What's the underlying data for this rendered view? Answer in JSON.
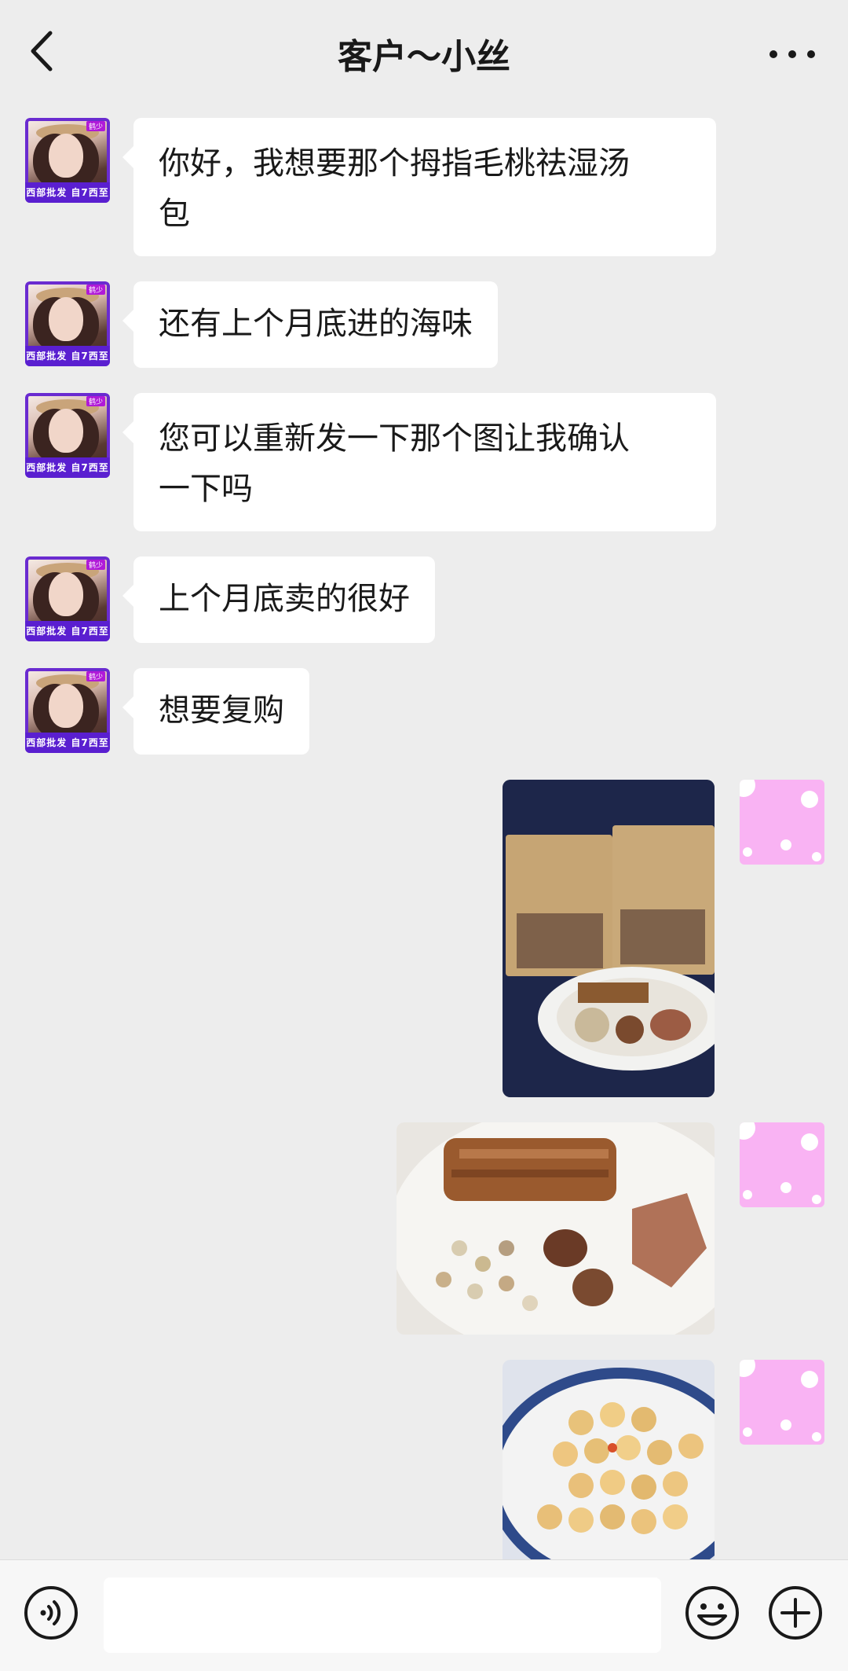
{
  "header": {
    "title": "客户～小丝",
    "back_icon": "chevron-left-icon",
    "more_icon": "more-horizontal-icon"
  },
  "contact_avatar": {
    "banner_text": "西部批发 自7西至",
    "tag_text": "鹤少"
  },
  "messages": [
    {
      "sender": "contact",
      "type": "text",
      "text": "你好，我想要那个拇指毛桃祛湿汤\n包"
    },
    {
      "sender": "contact",
      "type": "text",
      "text": "还有上个月底进的海味"
    },
    {
      "sender": "contact",
      "type": "text",
      "text": "您可以重新发一下那个图让我确认\n一下吗"
    },
    {
      "sender": "contact",
      "type": "text",
      "text": "上个月底卖的很好"
    },
    {
      "sender": "contact",
      "type": "text",
      "text": "想要复购"
    },
    {
      "sender": "self",
      "type": "image",
      "content": "photo of two soup ingredient packs and a plate of dried herbs"
    },
    {
      "sender": "self",
      "type": "image",
      "content": "photo of plate with dried roots, seeds and mushrooms"
    },
    {
      "sender": "self",
      "type": "image",
      "content": "photo of plate with dried scallops"
    }
  ],
  "colors": {
    "background": "#ededed",
    "bubble": "#ffffff",
    "self_avatar": "#f9b3f3",
    "contact_avatar_border": "#6a2bd0"
  },
  "input_bar": {
    "placeholder": "",
    "voice_icon": "voice-icon",
    "emoji_icon": "emoji-icon",
    "plus_icon": "plus-icon"
  }
}
